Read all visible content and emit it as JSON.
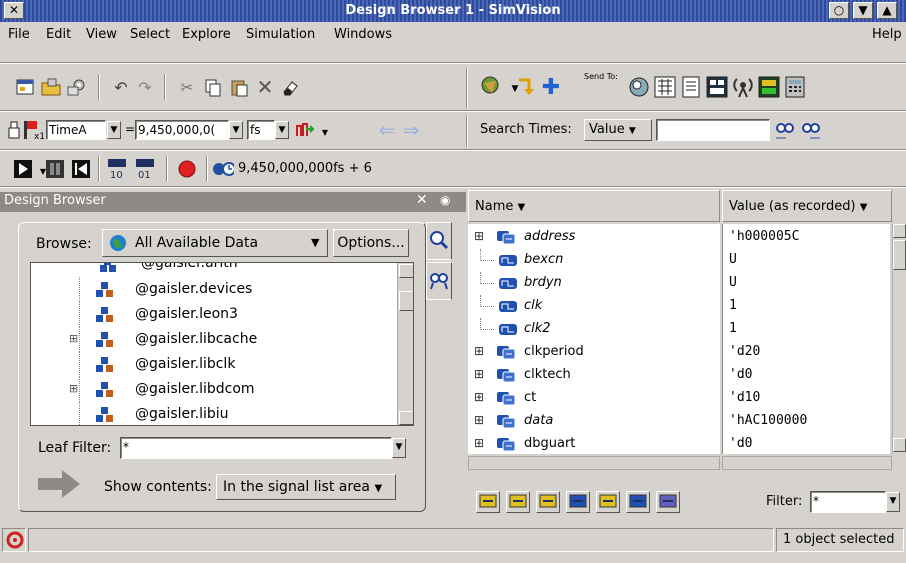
{
  "window": {
    "title": "Design Browser 1 - SimVision"
  },
  "menu": {
    "file": "File",
    "edit": "Edit",
    "view": "View",
    "select": "Select",
    "explore": "Explore",
    "simulation": "Simulation",
    "windows": "Windows",
    "help": "Help"
  },
  "toolbar2": {
    "timea_label": "TimeA",
    "equals": "=",
    "time_value": "9,450,000,0(",
    "unit": "fs",
    "search_times_label": "Search Times:",
    "search_mode": "Value",
    "send_to_label": "Send To:"
  },
  "toolbar3": {
    "time_readout": "9,450,000,000fs + 6"
  },
  "design_browser": {
    "header": "Design Browser",
    "browse_label": "Browse:",
    "browse_value": "All Available Data",
    "options_label": "Options...",
    "tree_partial": "@gaisler.arith",
    "tree_items": [
      {
        "label": "@gaisler.devices",
        "expandable": false
      },
      {
        "label": "@gaisler.leon3",
        "expandable": false
      },
      {
        "label": "@gaisler.libcache",
        "expandable": true
      },
      {
        "label": "@gaisler.libclk",
        "expandable": false
      },
      {
        "label": "@gaisler.libdcom",
        "expandable": true
      },
      {
        "label": "@gaisler.libiu",
        "expandable": false
      }
    ],
    "leaf_filter_label": "Leaf Filter:",
    "leaf_filter_value": "*",
    "show_contents_label": "Show contents:",
    "show_contents_value": "In the signal list area"
  },
  "signal_list": {
    "name_header": "Name",
    "value_header": "Value (as recorded)",
    "rows": [
      {
        "name": "address",
        "value": "'h000005C",
        "italic": true,
        "expandable": true,
        "kind": "bus"
      },
      {
        "name": "bexcn",
        "value": "U",
        "italic": true,
        "expandable": false,
        "kind": "wire"
      },
      {
        "name": "brdyn",
        "value": "U",
        "italic": true,
        "expandable": false,
        "kind": "wire"
      },
      {
        "name": "clk",
        "value": "1",
        "italic": true,
        "expandable": false,
        "kind": "wire"
      },
      {
        "name": "clk2",
        "value": "1",
        "italic": true,
        "expandable": false,
        "kind": "wire"
      },
      {
        "name": "clkperiod",
        "value": "'d20",
        "italic": false,
        "expandable": true,
        "kind": "bus"
      },
      {
        "name": "clktech",
        "value": "'d0",
        "italic": false,
        "expandable": true,
        "kind": "bus"
      },
      {
        "name": "ct",
        "value": "'d10",
        "italic": false,
        "expandable": true,
        "kind": "bus"
      },
      {
        "name": "data",
        "value": "'hAC100000",
        "italic": true,
        "expandable": true,
        "kind": "bus"
      },
      {
        "name": "dbguart",
        "value": "'d0",
        "italic": false,
        "expandable": true,
        "kind": "bus"
      }
    ],
    "filter_label": "Filter:",
    "filter_value": "*"
  },
  "status": {
    "message": "1 object selected"
  }
}
